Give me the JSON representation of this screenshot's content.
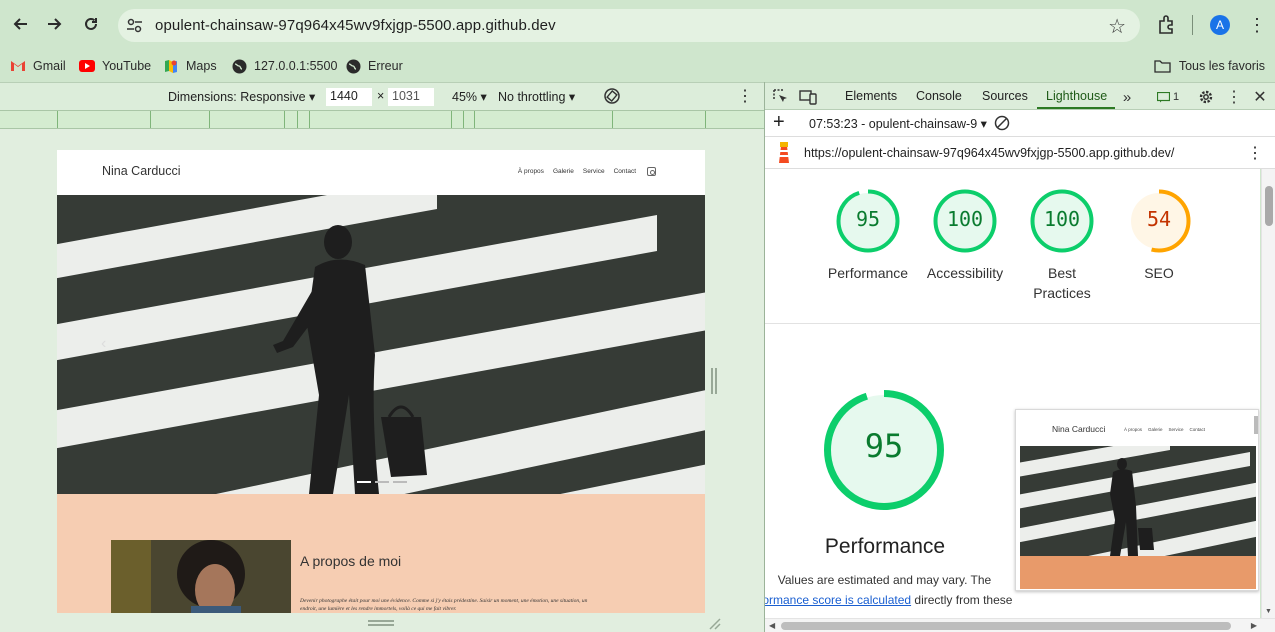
{
  "browser": {
    "url": "opulent-chainsaw-97q964x45wv9fxjgp-5500.app.github.dev",
    "profile_initial": "A",
    "bookmarks": [
      {
        "label": "Gmail",
        "icon": "gmail-icon"
      },
      {
        "label": "YouTube",
        "icon": "youtube-icon"
      },
      {
        "label": "Maps",
        "icon": "maps-icon"
      },
      {
        "label": "127.0.0.1:5500",
        "icon": "globe-icon"
      },
      {
        "label": "Erreur",
        "icon": "globe-icon"
      }
    ],
    "all_bookmarks_label": "Tous les favoris"
  },
  "device_toolbar": {
    "dimensions_label": "Dimensions: Responsive",
    "width": "1440",
    "times": "×",
    "height": "1031",
    "zoom": "45%",
    "throttling": "No throttling"
  },
  "site": {
    "name": "Nina Carducci",
    "nav": [
      "À propos",
      "Galerie",
      "Service",
      "Contact"
    ],
    "about_title": "A propos de moi",
    "about_text": "Devenir photographe était pour moi une évidence. Comme si j'y étais prédestine. Saisir un moment, une émotion, une situation, un endroit, une lumière et les rendre immortels, voilà ce qui me fait vibrer."
  },
  "devtools": {
    "tabs": [
      "Elements",
      "Console",
      "Sources",
      "Lighthouse"
    ],
    "active_tab": "Lighthouse",
    "issues_count": "1",
    "report_select": "07:53:23 - opulent-chainsaw-9",
    "report_url": "https://opulent-chainsaw-97q964x45wv9fxjgp-5500.app.github.dev/"
  },
  "lighthouse": {
    "scores": [
      {
        "label": "Performance",
        "value": "95",
        "score": 95,
        "status": "pass"
      },
      {
        "label": "Accessibility",
        "value": "100",
        "score": 100,
        "status": "pass"
      },
      {
        "label": "Best Practices",
        "value": "100",
        "score": 100,
        "status": "pass"
      },
      {
        "label": "SEO",
        "value": "54",
        "score": 54,
        "status": "average"
      }
    ],
    "main_score": "95",
    "main_label": "Performance",
    "note_line1": "Values are estimated and may vary. The",
    "note_link": "rformance score is calculated",
    "note_after_link": "directly from these",
    "screenshot_site_name": "Nina Carducci",
    "screenshot_nav": [
      "À propos",
      "Galerie",
      "Service",
      "Contact"
    ]
  },
  "colors": {
    "pass": "#0cce6b",
    "pass_text": "#0a7b2f",
    "pass_bg": "#e6f9ee",
    "average": "#ffa400",
    "average_text": "#c33300",
    "average_bg": "#fff6e6",
    "browser_bg": "#cfe6cd"
  }
}
